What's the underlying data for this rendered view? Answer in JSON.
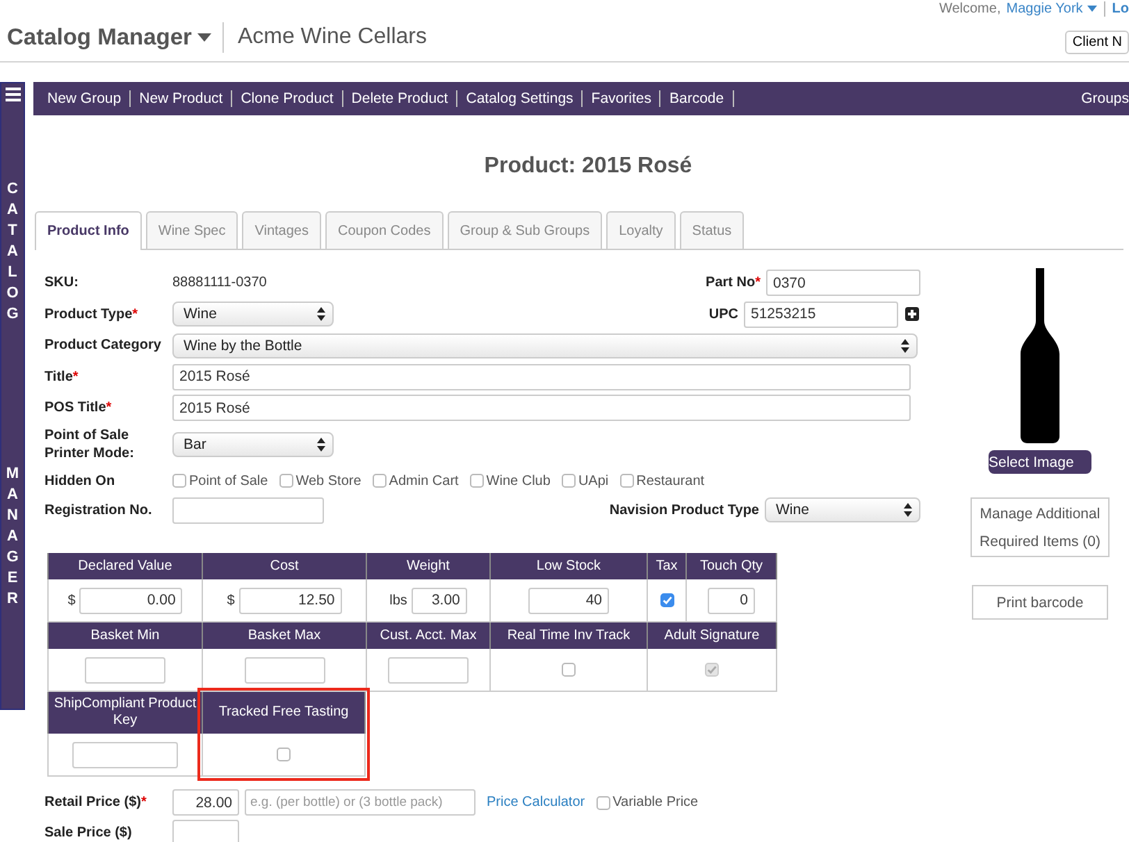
{
  "header": {
    "app_title": "Catalog Manager",
    "account": "Acme Wine Cellars",
    "welcome": "Welcome,",
    "user": "Maggie York",
    "logout": "Lo",
    "client_button": "Client N"
  },
  "sidebar": {
    "label_top": "CATALOG",
    "label_bottom": "MANAGER"
  },
  "toolbar": {
    "items": [
      "New Group",
      "New Product",
      "Clone Product",
      "Delete Product",
      "Catalog Settings",
      "Favorites",
      "Barcode"
    ],
    "right_item": "Groups"
  },
  "page_title": "Product: 2015 Rosé",
  "tabs": [
    {
      "label": "Product Info",
      "selected": true
    },
    {
      "label": "Wine Spec",
      "selected": false
    },
    {
      "label": "Vintages",
      "selected": false
    },
    {
      "label": "Coupon Codes",
      "selected": false
    },
    {
      "label": "Group & Sub Groups",
      "selected": false
    },
    {
      "label": "Loyalty",
      "selected": false
    },
    {
      "label": "Status",
      "selected": false
    }
  ],
  "form": {
    "sku": {
      "label": "SKU:",
      "value": "88881111-0370"
    },
    "part_no": {
      "label": "Part No",
      "required_mark": "*",
      "value": "0370"
    },
    "product_type": {
      "label": "Product Type",
      "required_mark": "*",
      "value": "Wine"
    },
    "upc": {
      "label": "UPC",
      "value": "51253215"
    },
    "product_category": {
      "label": "Product Category",
      "value": "Wine by the Bottle"
    },
    "title": {
      "label": "Title",
      "required_mark": "*",
      "value": "2015 Rosé"
    },
    "pos_title": {
      "label": "POS Title",
      "required_mark": "*",
      "value": "2015 Rosé"
    },
    "printer_mode": {
      "label": "Point of Sale Printer Mode:",
      "value": "Bar"
    },
    "hidden_on": {
      "label": "Hidden On",
      "options": [
        {
          "label": "Point of Sale",
          "checked": false
        },
        {
          "label": "Web Store",
          "checked": false
        },
        {
          "label": "Admin Cart",
          "checked": false
        },
        {
          "label": "Wine Club",
          "checked": false
        },
        {
          "label": "UApi",
          "checked": false
        },
        {
          "label": "Restaurant",
          "checked": false
        }
      ]
    },
    "registration_no": {
      "label": "Registration No."
    },
    "navision_type": {
      "label": "Navision Product Type",
      "value": "Wine"
    },
    "retail_price": {
      "label": "Retail Price ($)",
      "required_mark": "*",
      "value": "28.00",
      "note_placeholder": "e.g. (per bottle) or (3 bottle pack)",
      "link": "Price Calculator",
      "variable_price": {
        "label": "Variable Price",
        "checked": false
      }
    },
    "sale_price": {
      "label": "Sale Price ($)"
    }
  },
  "attributes_table": {
    "bands": [
      [
        {
          "header": "Declared Value",
          "kind": "money",
          "prefix": "$",
          "value": "0.00",
          "highlighted": false
        },
        {
          "header": "Cost",
          "kind": "money",
          "prefix": "$",
          "value": "12.50",
          "highlighted": false
        },
        {
          "header": "Weight",
          "kind": "money",
          "prefix": "lbs",
          "value": "3.00",
          "highlighted": false
        },
        {
          "header": "Low Stock",
          "kind": "input",
          "value": "40",
          "highlighted": false
        },
        {
          "header": "Tax",
          "kind": "checkbox",
          "checked": true,
          "disabled": false,
          "highlighted": false
        },
        {
          "header": "Touch Qty",
          "kind": "input",
          "value": "0",
          "highlighted": false
        }
      ],
      [
        {
          "header": "Basket Min",
          "kind": "input",
          "highlighted": false
        },
        {
          "header": "Basket Max",
          "kind": "input",
          "highlighted": false
        },
        {
          "header": "Cust. Acct. Max",
          "kind": "input",
          "highlighted": false
        },
        {
          "header": "Real Time Inv Track",
          "kind": "checkbox",
          "checked": false,
          "disabled": false,
          "highlighted": false
        },
        {
          "header": "Adult Signature",
          "kind": "checkbox",
          "checked": true,
          "disabled": true,
          "highlighted": false
        }
      ],
      [
        {
          "header": "ShipCompliant Product Key",
          "kind": "input",
          "highlighted": false
        },
        {
          "header": "Tracked Free Tasting",
          "kind": "checkbox",
          "checked": false,
          "disabled": false,
          "highlighted": true
        }
      ]
    ]
  },
  "image_panel": {
    "select_button": "Select Image",
    "manage_button": "Manage Additional Required Items (0)",
    "barcode_button": "Print barcode"
  }
}
